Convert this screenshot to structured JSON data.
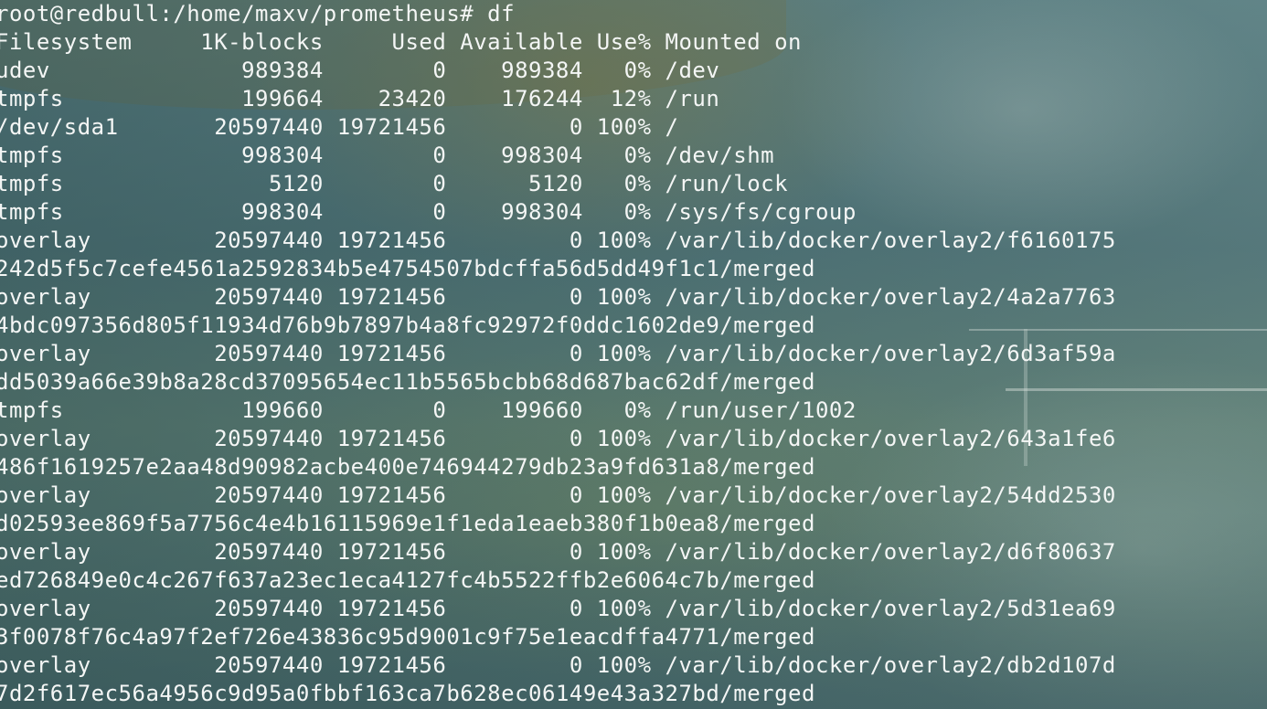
{
  "terminal": {
    "lines": [
      "root@redbull:/home/maxv/prometheus# df",
      "Filesystem     1K-blocks     Used Available Use% Mounted on",
      "udev              989384        0    989384   0% /dev",
      "tmpfs             199664    23420    176244  12% /run",
      "/dev/sda1       20597440 19721456         0 100% /",
      "tmpfs             998304        0    998304   0% /dev/shm",
      "tmpfs               5120        0      5120   0% /run/lock",
      "tmpfs             998304        0    998304   0% /sys/fs/cgroup",
      "overlay         20597440 19721456         0 100% /var/lib/docker/overlay2/f6160175",
      "242d5f5c7cefe4561a2592834b5e4754507bdcffa56d5dd49f1c1/merged",
      "overlay         20597440 19721456         0 100% /var/lib/docker/overlay2/4a2a7763",
      "4bdc097356d805f11934d76b9b7897b4a8fc92972f0ddc1602de9/merged",
      "overlay         20597440 19721456         0 100% /var/lib/docker/overlay2/6d3af59a",
      "dd5039a66e39b8a28cd37095654ec11b5565bcbb68d687bac62df/merged",
      "tmpfs             199660        0    199660   0% /run/user/1002",
      "overlay         20597440 19721456         0 100% /var/lib/docker/overlay2/643a1fe6",
      "486f1619257e2aa48d90982acbe400e746944279db23a9fd631a8/merged",
      "overlay         20597440 19721456         0 100% /var/lib/docker/overlay2/54dd2530",
      "d02593ee869f5a7756c4e4b16115969e1f1eda1eaeb380f1b0ea8/merged",
      "overlay         20597440 19721456         0 100% /var/lib/docker/overlay2/d6f80637",
      "ed726849e0c4c267f637a23ec1eca4127fc4b5522ffb2e6064c7b/merged",
      "overlay         20597440 19721456         0 100% /var/lib/docker/overlay2/5d31ea69",
      "3f0078f76c4a97f2ef726e43836c95d9001c9f75e1eacdffa4771/merged",
      "overlay         20597440 19721456         0 100% /var/lib/docker/overlay2/db2d107d",
      "7d2f617ec56a4956c9d95a0fbbf163ca7b628ec06149e43a327bd/merged"
    ]
  },
  "colors": {
    "text": "#f4f6f5",
    "background": "#4f7478"
  }
}
